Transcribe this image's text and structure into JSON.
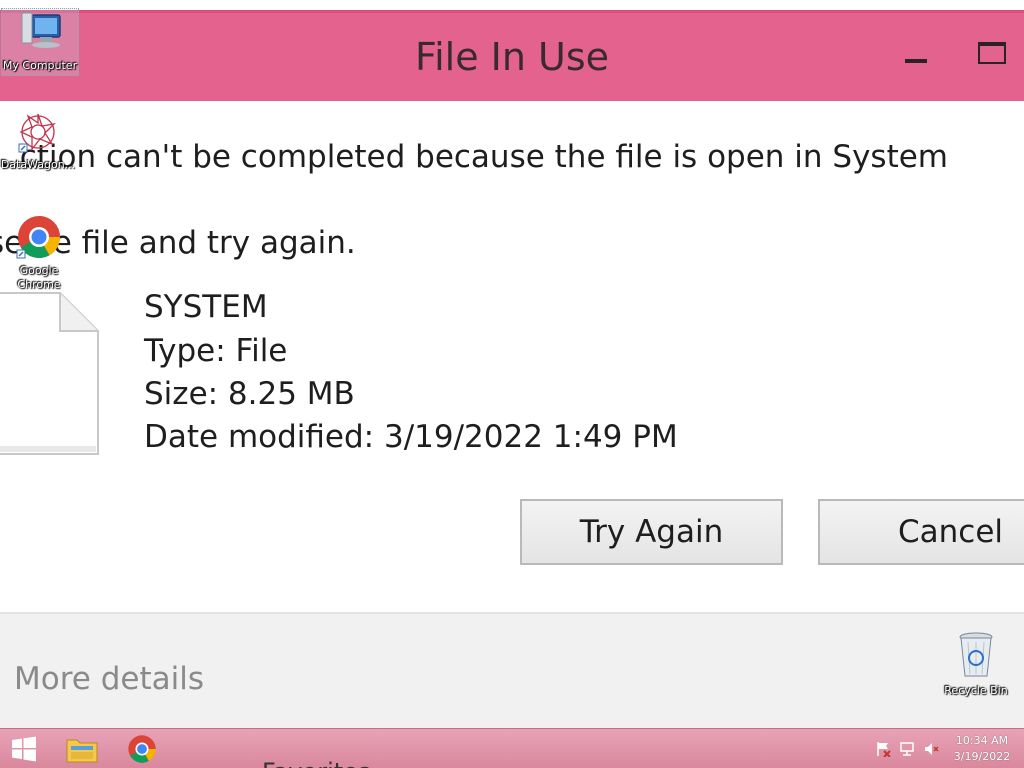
{
  "dialog": {
    "title": "File In Use",
    "message_line1": ". ction can't be completed because the file is open in System",
    "message_line2": "se  he file and try again.",
    "file": {
      "name": "SYSTEM",
      "type": "Type: File",
      "size": "Size: 8.25 MB",
      "date_modified": "Date modified: 3/19/2022 1:49 PM"
    },
    "buttons": {
      "try_again": "Try Again",
      "cancel": "Cancel"
    },
    "more_details": "More details"
  },
  "desktop": {
    "icons": [
      {
        "label": "My Computer",
        "icon": "computer-icon"
      },
      {
        "label": "DataWagon...",
        "icon": "datawagon-icon"
      },
      {
        "label": "Google Chrome",
        "icon": "chrome-icon"
      },
      {
        "label": "Recycle Bin",
        "icon": "recycle-bin-icon"
      }
    ]
  },
  "taskbar": {
    "partial_text": "Favorites",
    "clock_time": "10:34 AM",
    "clock_date": "3/19/2022"
  },
  "colors": {
    "titlebar": "#e3638e",
    "taskbar": "#e0949f",
    "footer": "#f1f1f1"
  }
}
